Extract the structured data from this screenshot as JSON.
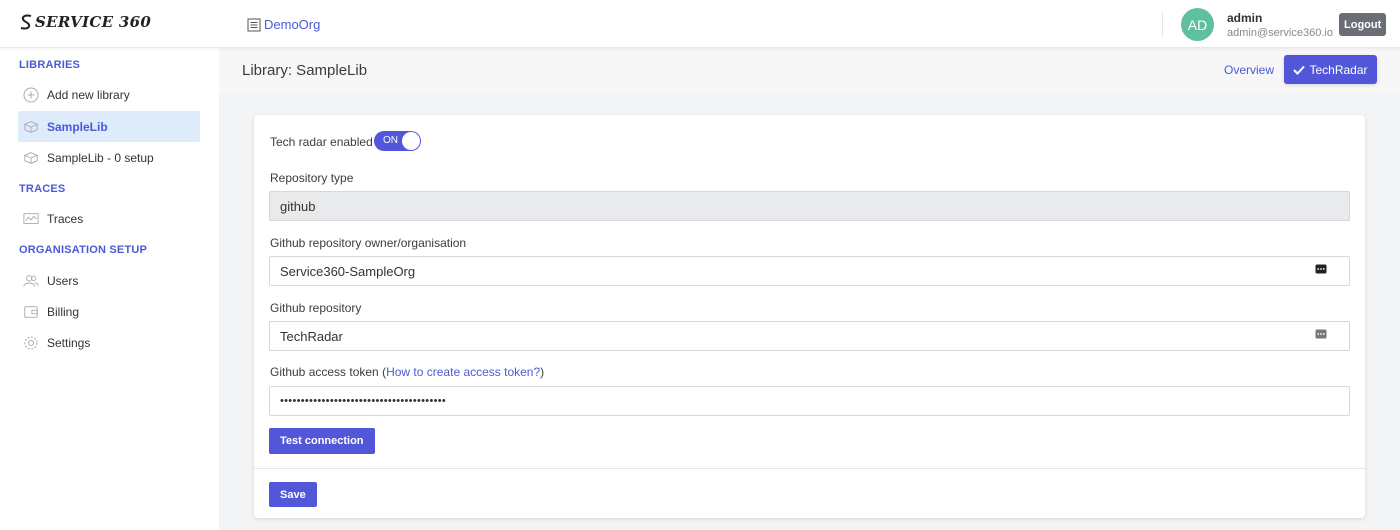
{
  "app": {
    "logo_text": "SERVICE 360",
    "org_name": "DemoOrg"
  },
  "user": {
    "initials": "AD",
    "name": "admin",
    "email": "admin@service360.io",
    "logout_label": "Logout"
  },
  "sidebar": {
    "sections": [
      {
        "title": "LIBRARIES"
      },
      {
        "title": "TRACES"
      },
      {
        "title": "ORGANISATION SETUP"
      }
    ],
    "items": [
      {
        "label": "Add new library",
        "icon": "plus-circle-icon"
      },
      {
        "label": "SampleLib",
        "icon": "box-icon",
        "active": true
      },
      {
        "label": "SampleLib - 0 setup",
        "icon": "box-icon"
      },
      {
        "label": "Traces",
        "icon": "chart-icon"
      },
      {
        "label": "Users",
        "icon": "users-icon"
      },
      {
        "label": "Billing",
        "icon": "wallet-icon"
      },
      {
        "label": "Settings",
        "icon": "gear-icon"
      }
    ]
  },
  "header": {
    "title": "Library: SampleLib",
    "overview_label": "Overview",
    "techradar_label": "TechRadar"
  },
  "form": {
    "tech_radar_label": "Tech radar enabled",
    "tech_radar_toggle": "ON",
    "repo_type_label": "Repository type",
    "repo_type_value": "github",
    "owner_label": "Github repository owner/organisation",
    "owner_value": "Service360-SampleOrg",
    "repo_label": "Github repository",
    "repo_value": "TechRadar",
    "token_label": "Github access token",
    "token_help_prefix": "(",
    "token_help_link": "How to create access token?",
    "token_help_suffix": ")",
    "token_value": "••••••••••••••••••••••••••••••••••••••••",
    "test_button": "Test connection",
    "save_button": "Save"
  },
  "colors": {
    "accent": "#5157d8",
    "link": "#4a5ad6",
    "avatar": "#5ec0a0",
    "active_nav_bg": "#deebfb"
  }
}
